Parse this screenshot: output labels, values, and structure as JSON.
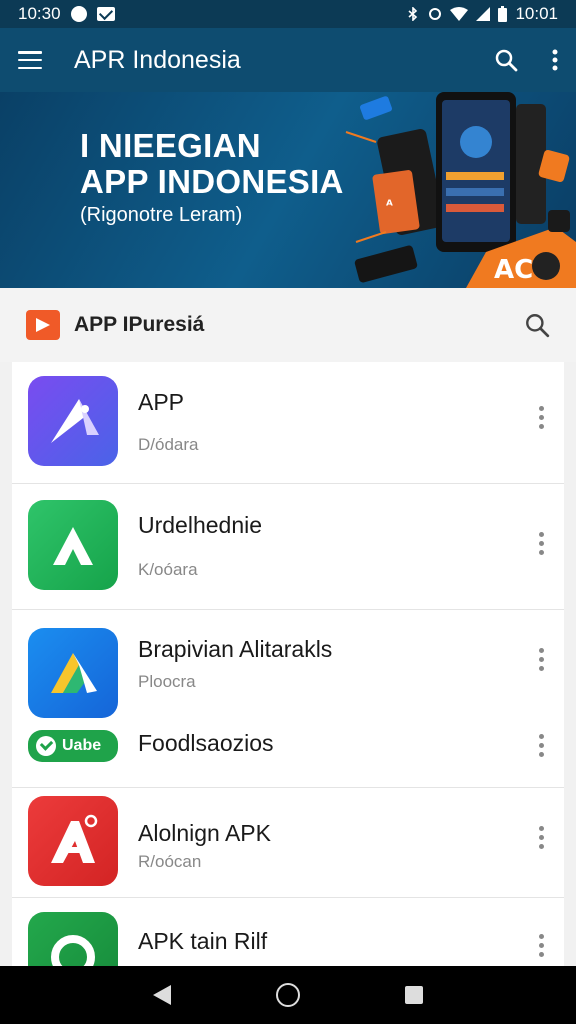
{
  "status_bar": {
    "time_left": "10:30",
    "time_right": "10:01"
  },
  "app_bar": {
    "title": "APR Indonesia"
  },
  "banner": {
    "title_line1": "I NIEEGIAN",
    "title_line2": "APP INDONESIA",
    "subtitle": "(Rigonotre Leram)",
    "art_label": "AC"
  },
  "section": {
    "title": "APP IPuresiá"
  },
  "list": [
    {
      "title": "APP",
      "subtitle": "D/ódara",
      "icon": "app-icon-purple"
    },
    {
      "title": "Urdelhednie",
      "subtitle": "K/oóara",
      "icon": "app-icon-green"
    },
    {
      "title": "Brapivian Alitarakls",
      "subtitle": "Ploocra",
      "icon": "app-icon-blue",
      "extra_title": "Foodlsaozios",
      "badge": "Uabe"
    },
    {
      "title": "Alolnign APK",
      "subtitle": "R/oócan",
      "icon": "app-icon-red"
    },
    {
      "title": "APK tain Rilf",
      "subtitle": "",
      "icon": "app-icon-darkgreen"
    }
  ],
  "colors": {
    "app_bar": "#0e4c70",
    "status_bar": "#0c3a55",
    "accent": "#f05a28"
  }
}
